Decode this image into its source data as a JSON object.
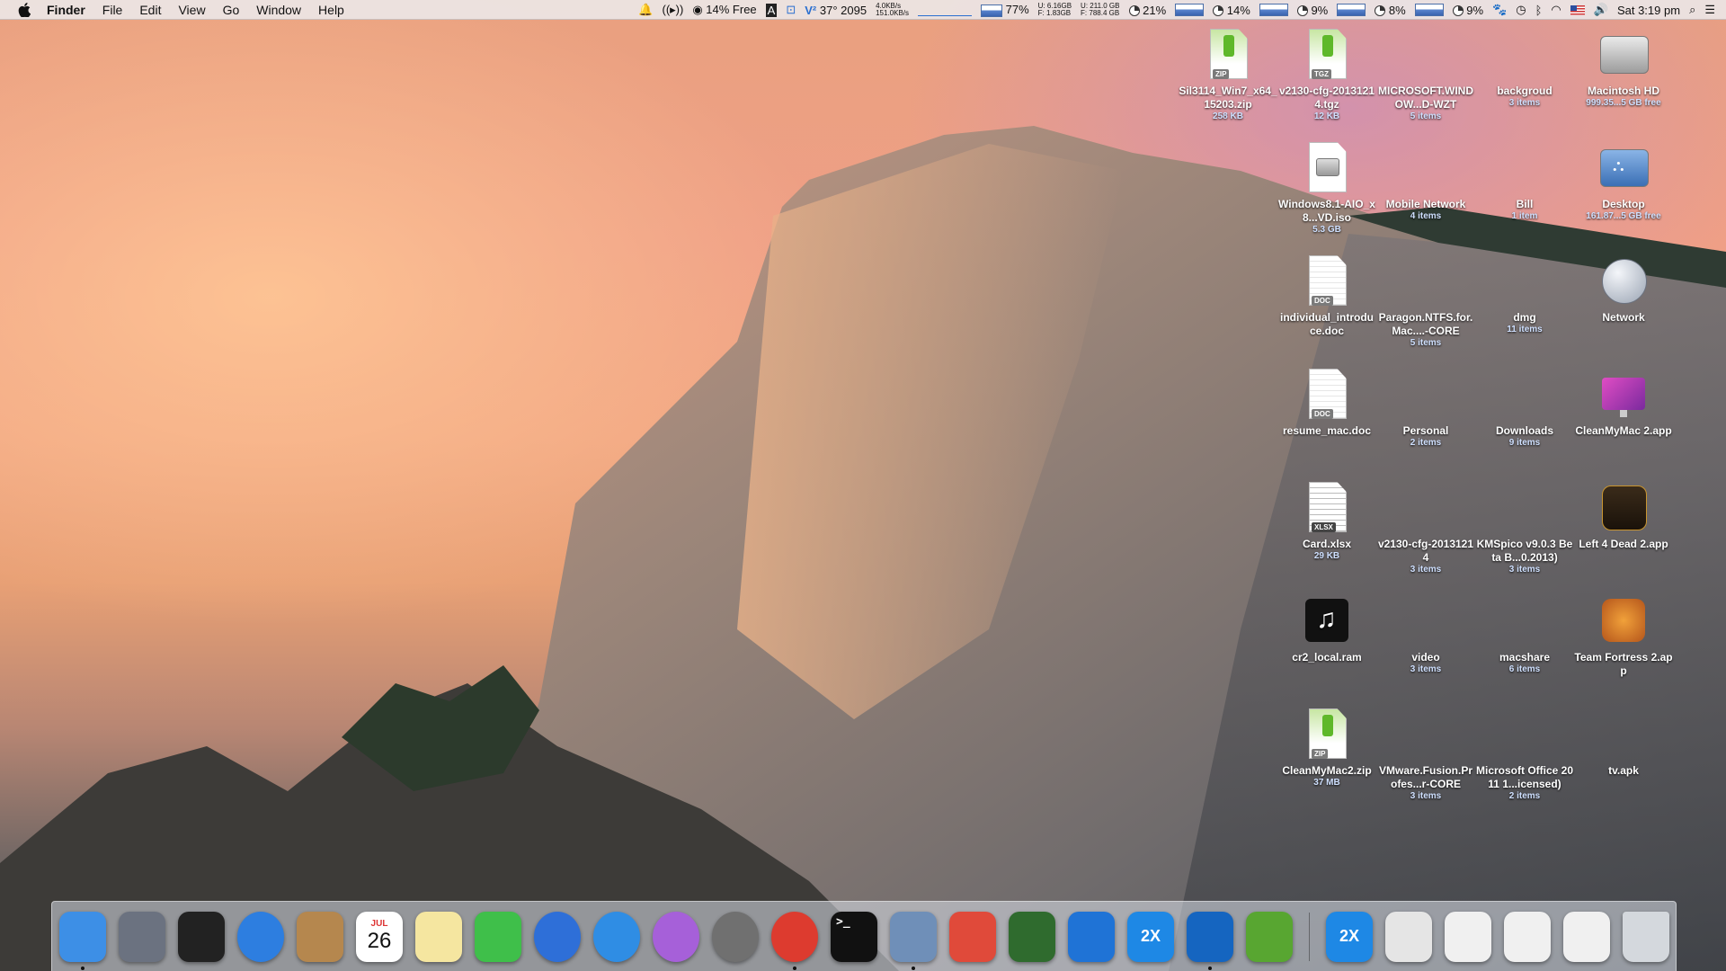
{
  "menubar": {
    "app_name": "Finder",
    "menus": [
      "File",
      "Edit",
      "View",
      "Go",
      "Window",
      "Help"
    ],
    "status": {
      "mem_free": "14% Free",
      "temp": "37°",
      "fan": "2095",
      "net_up": "4.0KB/s",
      "net_down": "151.0KB/s",
      "battery_pct": "77%",
      "mem_u": "6.16GB",
      "mem_f": "1.83GB",
      "disk_u": "211.0 GB",
      "disk_f": "788.4 GB",
      "cpu1": "21%",
      "cpu2": "14%",
      "cpu3": "9%",
      "cpu4": "8%",
      "cpu5": "9%",
      "clock": "Sat 3:19 pm"
    }
  },
  "desktop_icons": [
    {
      "name": "Sil3114_Win7_x64_15203.zip",
      "sub": "258 KB",
      "kind": "zip"
    },
    {
      "name": "v2130-cfg-20131214.tgz",
      "sub": "12 KB",
      "kind": "tgz"
    },
    {
      "name": "MICROSOFT.WINDOW...D-WZT",
      "sub": "5 items",
      "kind": "folder"
    },
    {
      "name": "backgroud",
      "sub": "3 items",
      "kind": "folder"
    },
    {
      "name": "Macintosh HD",
      "sub": "999.35...5 GB free",
      "kind": "hdd"
    },
    {
      "name": "Windows8.1-AIO_x8...VD.iso",
      "sub": "5.3 GB",
      "kind": "iso"
    },
    {
      "name": "Mobile Network",
      "sub": "4 items",
      "kind": "folder"
    },
    {
      "name": "Bill",
      "sub": "1 item",
      "kind": "folder"
    },
    {
      "name": "Desktop",
      "sub": "161.87...5 GB free",
      "kind": "network-drive"
    },
    {
      "name": "individual_introduce.doc",
      "sub": "",
      "kind": "doc"
    },
    {
      "name": "Paragon.NTFS.for.Mac....-CORE",
      "sub": "5 items",
      "kind": "folder"
    },
    {
      "name": "dmg",
      "sub": "11 items",
      "kind": "folder"
    },
    {
      "name": "Network",
      "sub": "",
      "kind": "globe"
    },
    {
      "name": "resume_mac.doc",
      "sub": "",
      "kind": "doc"
    },
    {
      "name": "Personal",
      "sub": "2 items",
      "kind": "folder"
    },
    {
      "name": "Downloads",
      "sub": "9 items",
      "kind": "folder"
    },
    {
      "name": "CleanMyMac 2.app",
      "sub": "",
      "kind": "app-cleanmymac"
    },
    {
      "name": "Card.xlsx",
      "sub": "29 KB",
      "kind": "xlsx"
    },
    {
      "name": "v2130-cfg-20131214",
      "sub": "3 items",
      "kind": "folder"
    },
    {
      "name": "KMSpico v9.0.3 Beta B...0.2013)",
      "sub": "3 items",
      "kind": "folder"
    },
    {
      "name": "Left 4 Dead 2.app",
      "sub": "",
      "kind": "app-l4d2"
    },
    {
      "name": "cr2_local.ram",
      "sub": "",
      "kind": "music"
    },
    {
      "name": "video",
      "sub": "3 items",
      "kind": "folder"
    },
    {
      "name": "macshare",
      "sub": "6 items",
      "kind": "folder"
    },
    {
      "name": "Team Fortress 2.app",
      "sub": "",
      "kind": "app-tf2"
    },
    {
      "name": "CleanMyMac2.zip",
      "sub": "37 MB",
      "kind": "zip"
    },
    {
      "name": "VMware.Fusion.Profes...r-CORE",
      "sub": "3 items",
      "kind": "folder"
    },
    {
      "name": "Microsoft Office 2011 1...icensed)",
      "sub": "2 items",
      "kind": "folder"
    },
    {
      "name": "tv.apk",
      "sub": "",
      "kind": "folder"
    }
  ],
  "icon_badges": {
    "zip": "ZIP",
    "tgz": "TGZ",
    "doc": "DOC",
    "xlsx": "XLSX",
    "calendar_month": "JUL",
    "calendar_day": "26",
    "twox": "2X"
  },
  "dock_items": [
    {
      "name": "finder",
      "color": "#3d8fe6"
    },
    {
      "name": "launchpad",
      "color": "#6b7280"
    },
    {
      "name": "mission-control",
      "color": "#222"
    },
    {
      "name": "safari",
      "color": "#2d7ee0"
    },
    {
      "name": "contacts",
      "color": "#b5874e"
    },
    {
      "name": "calendar",
      "color": "#ffffff"
    },
    {
      "name": "notes",
      "color": "#f5e6a0"
    },
    {
      "name": "facetime",
      "color": "#3fbf4a"
    },
    {
      "name": "itunes",
      "color": "#2e6fd8"
    },
    {
      "name": "app-store",
      "color": "#2f8de4"
    },
    {
      "name": "feedback",
      "color": "#a660d9"
    },
    {
      "name": "system-preferences",
      "color": "#707070"
    },
    {
      "name": "chrome",
      "color": "#dd3b2f"
    },
    {
      "name": "terminal",
      "color": "#111"
    },
    {
      "name": "preview",
      "color": "#6f8fb8"
    },
    {
      "name": "remote-desktop",
      "color": "#e04a3a"
    },
    {
      "name": "memory-monitor",
      "color": "#2f6b2e"
    },
    {
      "name": "teamviewer",
      "color": "#1f73d6"
    },
    {
      "name": "2x-client",
      "color": "#1e88e5"
    },
    {
      "name": "openoffice",
      "color": "#1565c0"
    },
    {
      "name": "utorrent",
      "color": "#58a631"
    },
    {
      "name": "2x-app",
      "color": "#1e88e5"
    },
    {
      "name": "file-stack",
      "color": "#e5e5e5"
    },
    {
      "name": "document-stack",
      "color": "#f0f0f0"
    },
    {
      "name": "window-stack",
      "color": "#f0f0f0"
    },
    {
      "name": "screenshot-stack",
      "color": "#f0f0f0"
    },
    {
      "name": "trash",
      "color": "#d4d8dd"
    }
  ]
}
